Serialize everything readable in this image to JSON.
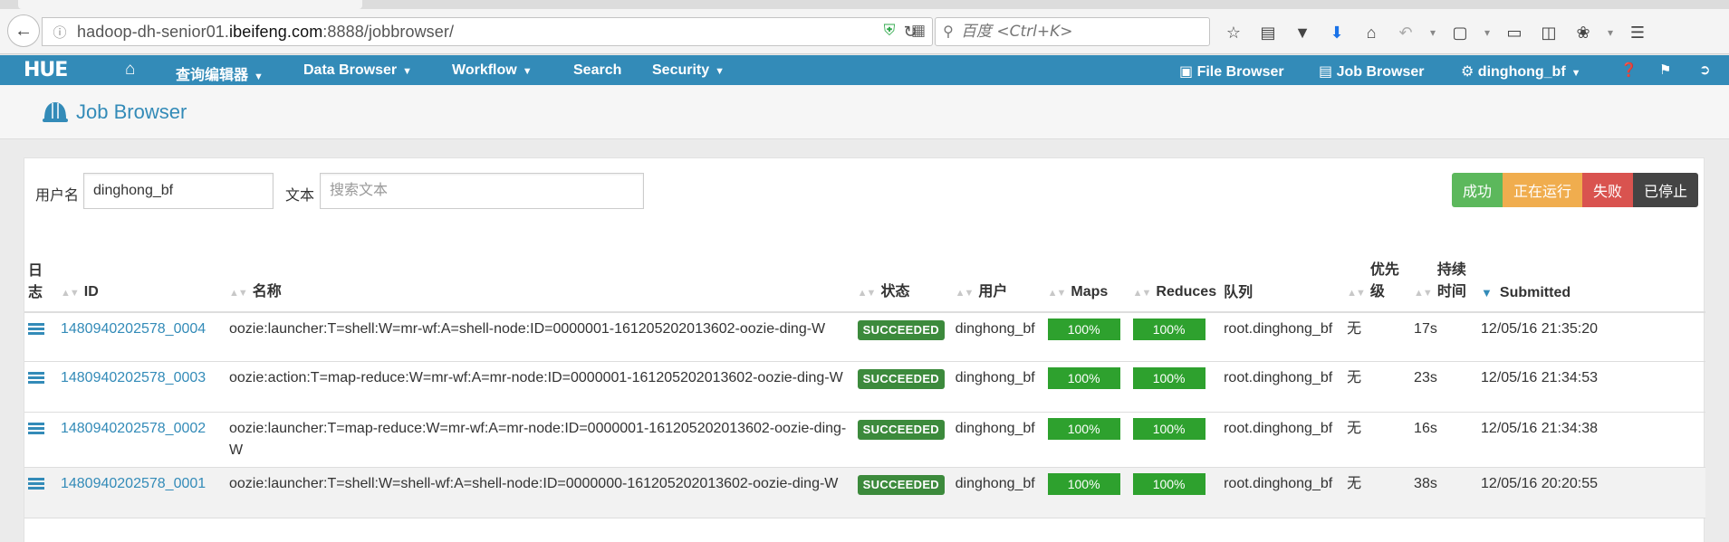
{
  "browser": {
    "url_prefix": "hadoop-dh-senior01.",
    "url_domain": "ibeifeng.com",
    "url_suffix": ":8888/jobbrowser/",
    "search_placeholder": "百度 <Ctrl+K>"
  },
  "nav": {
    "logo": "HUE",
    "items": [
      {
        "label": "查询编辑器"
      },
      {
        "label": "Data Browser"
      },
      {
        "label": "Workflow"
      },
      {
        "label": "Search"
      },
      {
        "label": "Security"
      }
    ],
    "file_browser": "File Browser",
    "job_browser": "Job Browser",
    "user": "dinghong_bf"
  },
  "page": {
    "title": "Job Browser"
  },
  "filters": {
    "user_label": "用户名",
    "user_value": "dinghong_bf",
    "text_label": "文本",
    "text_placeholder": "搜索文本",
    "status_buttons": {
      "success": "成功",
      "running": "正在运行",
      "failed": "失败",
      "stopped": "已停止"
    }
  },
  "table": {
    "headers": {
      "log": "日志",
      "id": "ID",
      "name": "名称",
      "status": "状态",
      "user": "用户",
      "maps": "Maps",
      "reduces": "Reduces",
      "queue": "队列",
      "priority": "优先级",
      "duration": "持续时间",
      "submitted": "Submitted"
    },
    "rows": [
      {
        "id": "1480940202578_0004",
        "name": "oozie:launcher:T=shell:W=mr-wf:A=shell-node:ID=0000001-161205202013602-oozie-ding-W",
        "status": "SUCCEEDED",
        "user": "dinghong_bf",
        "maps": "100%",
        "reduces": "100%",
        "queue": "root.dinghong_bf",
        "priority": "无",
        "duration": "17s",
        "submitted": "12/05/16 21:35:20"
      },
      {
        "id": "1480940202578_0003",
        "name": "oozie:action:T=map-reduce:W=mr-wf:A=mr-node:ID=0000001-161205202013602-oozie-ding-W",
        "status": "SUCCEEDED",
        "user": "dinghong_bf",
        "maps": "100%",
        "reduces": "100%",
        "queue": "root.dinghong_bf",
        "priority": "无",
        "duration": "23s",
        "submitted": "12/05/16 21:34:53"
      },
      {
        "id": "1480940202578_0002",
        "name": "oozie:launcher:T=map-reduce:W=mr-wf:A=mr-node:ID=0000001-161205202013602-oozie-ding-W",
        "status": "SUCCEEDED",
        "user": "dinghong_bf",
        "maps": "100%",
        "reduces": "100%",
        "queue": "root.dinghong_bf",
        "priority": "无",
        "duration": "16s",
        "submitted": "12/05/16 21:34:38"
      },
      {
        "id": "1480940202578_0001",
        "name": "oozie:launcher:T=shell:W=shell-wf:A=shell-node:ID=0000000-161205202013602-oozie-ding-W",
        "status": "SUCCEEDED",
        "user": "dinghong_bf",
        "maps": "100%",
        "reduces": "100%",
        "queue": "root.dinghong_bf",
        "priority": "无",
        "duration": "38s",
        "submitted": "12/05/16 20:20:55"
      }
    ]
  },
  "colors": {
    "hue_blue": "#338bb8",
    "success_green": "#5cb85c",
    "running_orange": "#f0ad4e",
    "failed_red": "#d9534f",
    "stopped_dark": "#444444",
    "progress_green": "#2ea12e"
  }
}
